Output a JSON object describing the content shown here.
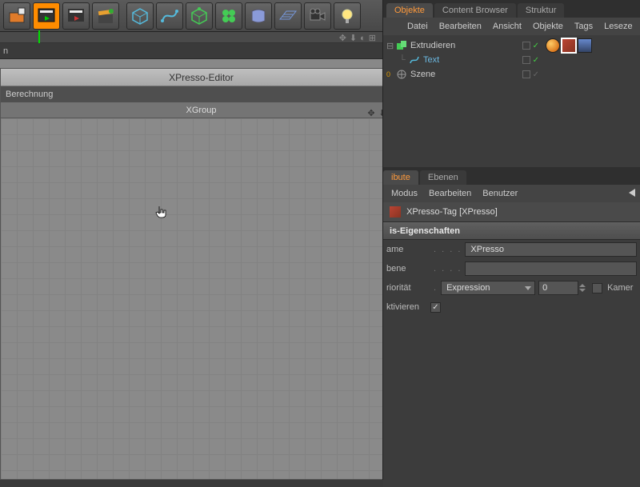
{
  "toolbar": {
    "timeline_label": "n"
  },
  "move_icons": {
    "cross": "✥",
    "down": "⬇"
  },
  "xpresso": {
    "title": "XPresso-Editor",
    "menu_berechnung": "Berechnung",
    "group_label": "XGroup"
  },
  "right": {
    "tabs": {
      "objekte": "Objekte",
      "content_browser": "Content Browser",
      "struktur": "Struktur"
    },
    "menu": {
      "datei": "Datei",
      "bearbeiten": "Bearbeiten",
      "ansicht": "Ansicht",
      "objekte": "Objekte",
      "tags": "Tags",
      "lesezeichen": "Leseze"
    }
  },
  "tree": {
    "items": [
      {
        "label": "Extrudieren",
        "linked": false
      },
      {
        "label": "Text",
        "linked": true
      },
      {
        "label": "Szene",
        "linked": false
      }
    ]
  },
  "attr_tabs": {
    "attribute": "ibute",
    "ebenen": "Ebenen"
  },
  "attr_menu": {
    "modus": "Modus",
    "bearbeiten": "Bearbeiten",
    "benutzer": "Benutzer"
  },
  "attr": {
    "title": "XPresso-Tag [XPresso]",
    "section": "is-Eigenschaften",
    "name_label": "ame",
    "name_value": "XPresso",
    "ebene_label": "bene",
    "ebene_value": "",
    "prio_label": "riorität",
    "prio_select": "Expression",
    "prio_num": "0",
    "kamera_label": "Kamer",
    "aktiv_label": "ktivieren"
  }
}
